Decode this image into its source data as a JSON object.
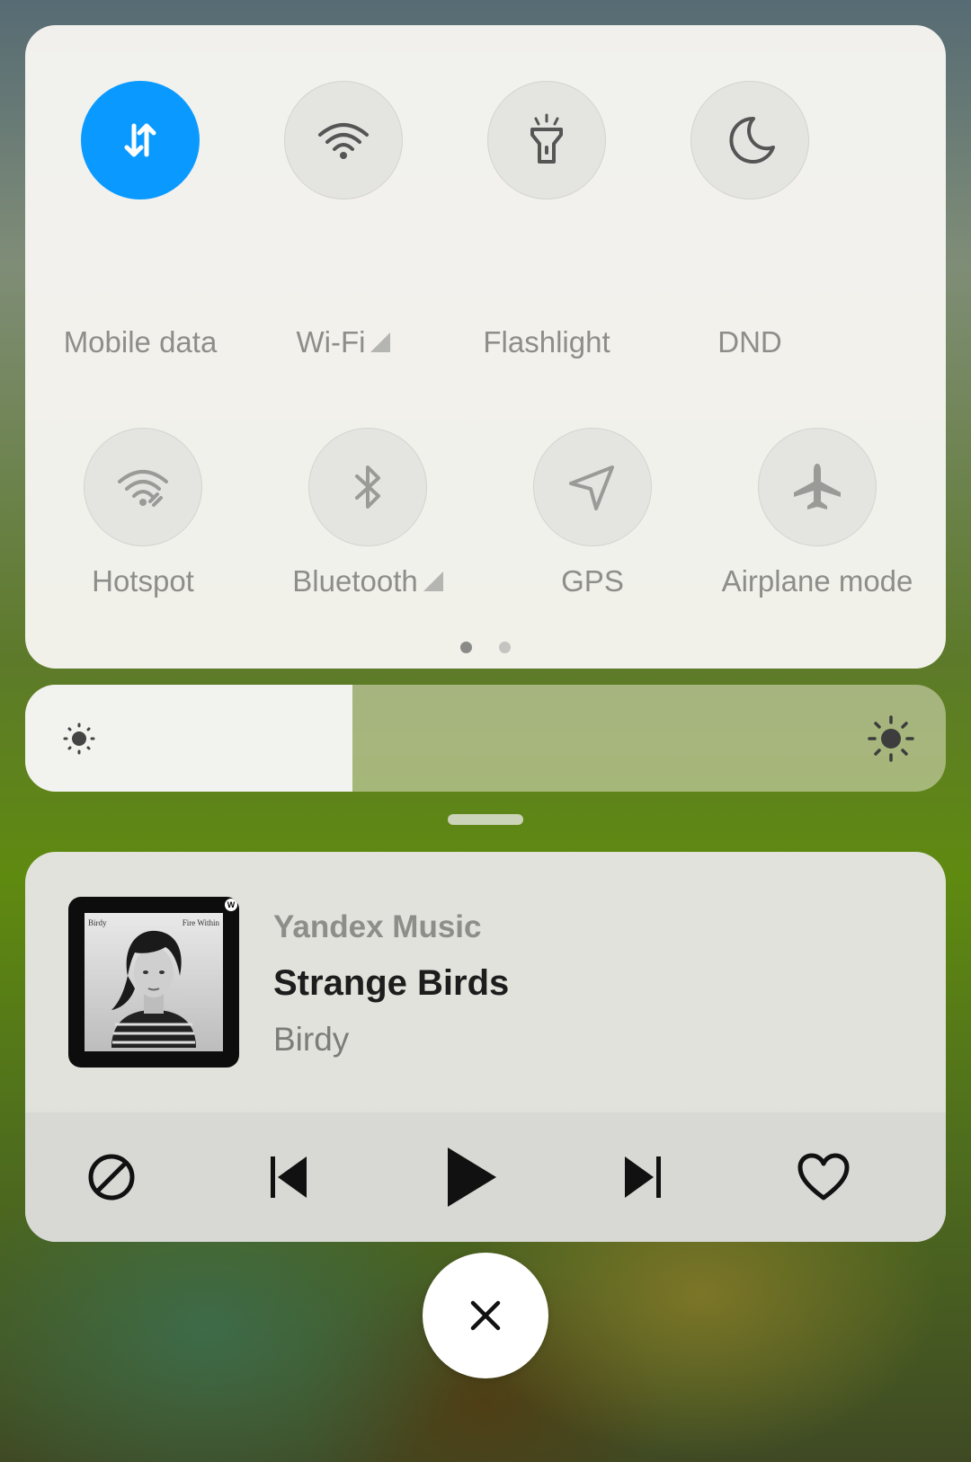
{
  "quick_toggles": {
    "row1": [
      {
        "label": "Mobile data",
        "icon": "mobile-data-icon",
        "active": true,
        "has_arrow": false
      },
      {
        "label": "Wi-Fi",
        "icon": "wifi-icon",
        "active": false,
        "has_arrow": true
      },
      {
        "label": "Flashlight",
        "icon": "flashlight-icon",
        "active": false,
        "has_arrow": false
      },
      {
        "label": "DND",
        "icon": "moon-icon",
        "active": false,
        "has_arrow": false
      }
    ],
    "row2": [
      {
        "label": "Hotspot",
        "icon": "hotspot-icon",
        "active": false,
        "has_arrow": false
      },
      {
        "label": "Bluetooth",
        "icon": "bluetooth-icon",
        "active": false,
        "has_arrow": true
      },
      {
        "label": "GPS",
        "icon": "location-arrow-icon",
        "active": false,
        "has_arrow": false
      },
      {
        "label": "Airplane mode",
        "icon": "airplane-icon",
        "active": false,
        "has_arrow": false
      }
    ],
    "page_count": 2,
    "current_page": 1
  },
  "brightness": {
    "level_fraction": 0.355,
    "low_icon": "sun-small-icon",
    "high_icon": "sun-large-icon"
  },
  "media": {
    "app_name": "Yandex Music",
    "title": "Strange Birds",
    "artist": "Birdy",
    "album_art_text_left": "Birdy",
    "album_art_text_right": "Fire Within",
    "album_art_badge": "W",
    "controls": [
      "block-icon",
      "skip-previous-icon",
      "play-icon",
      "skip-next-icon",
      "heart-icon"
    ]
  },
  "colors": {
    "accent": "#0a9aff",
    "panel": "#f6f5f1",
    "label_gray": "#8d8d8a"
  },
  "close_button": {
    "icon": "close-icon"
  }
}
